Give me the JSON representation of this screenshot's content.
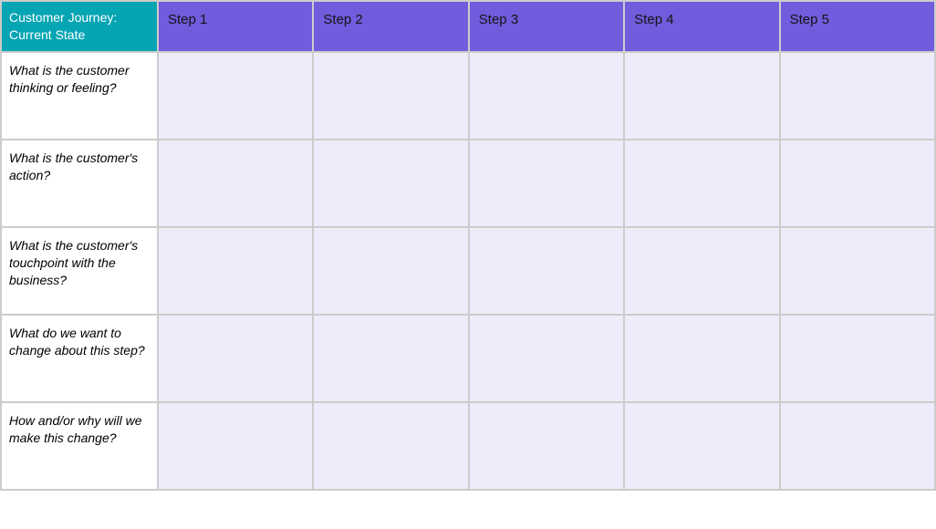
{
  "header": {
    "title": "Customer Journey: Current State",
    "steps": [
      "Step 1",
      "Step 2",
      "Step 3",
      "Step 4",
      "Step 5"
    ]
  },
  "rows": [
    {
      "label": "What is the customer thinking or feeling?",
      "cells": [
        "",
        "",
        "",
        "",
        ""
      ]
    },
    {
      "label": "What is the customer's action?",
      "cells": [
        "",
        "",
        "",
        "",
        ""
      ]
    },
    {
      "label": "What is the customer's touchpoint with the business?",
      "cells": [
        "",
        "",
        "",
        "",
        ""
      ]
    },
    {
      "label": "What do we want to change about this step?",
      "cells": [
        "",
        "",
        "",
        "",
        ""
      ]
    },
    {
      "label": "How and/or why will we make this change?",
      "cells": [
        "",
        "",
        "",
        "",
        ""
      ]
    }
  ]
}
